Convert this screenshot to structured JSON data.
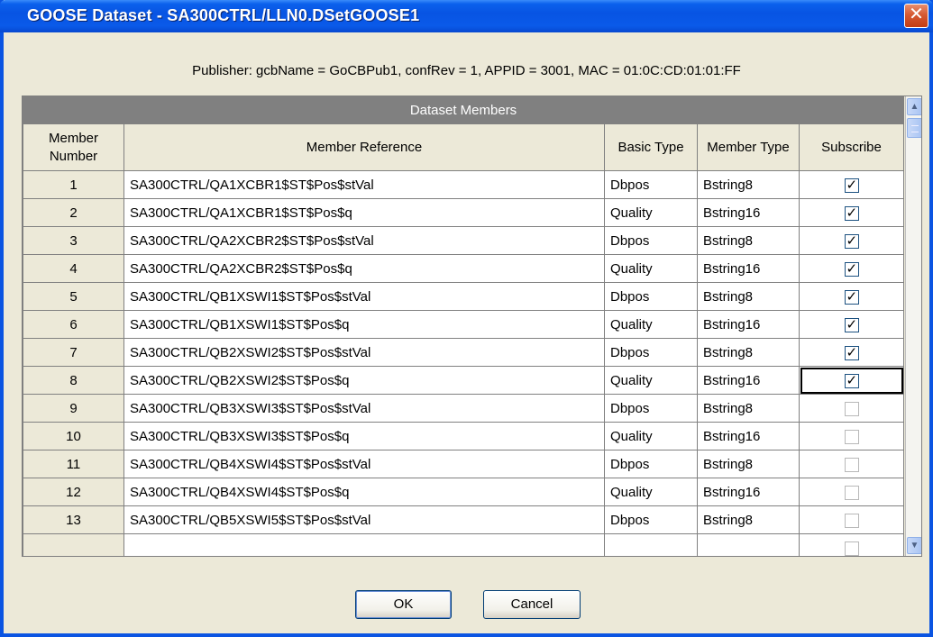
{
  "window": {
    "title": "GOOSE Dataset - SA300CTRL/LLN0.DSetGOOSE1",
    "close_glyph": "✕"
  },
  "publisher_info": "Publisher: gcbName = GoCBPub1, confRev = 1, APPID = 3001, MAC = 01:0C:CD:01:01:FF",
  "grid": {
    "banner": "Dataset Members",
    "headers": {
      "member_number": "Member Number",
      "member_reference": "Member Reference",
      "basic_type": "Basic Type",
      "member_type": "Member Type",
      "subscribe": "Subscribe"
    },
    "rows": [
      {
        "number": "1",
        "reference": "SA300CTRL/QA1XCBR1$ST$Pos$stVal",
        "basic_type": "Dbpos",
        "member_type": "Bstring8",
        "subscribe": true
      },
      {
        "number": "2",
        "reference": "SA300CTRL/QA1XCBR1$ST$Pos$q",
        "basic_type": "Quality",
        "member_type": "Bstring16",
        "subscribe": true
      },
      {
        "number": "3",
        "reference": "SA300CTRL/QA2XCBR2$ST$Pos$stVal",
        "basic_type": "Dbpos",
        "member_type": "Bstring8",
        "subscribe": true
      },
      {
        "number": "4",
        "reference": "SA300CTRL/QA2XCBR2$ST$Pos$q",
        "basic_type": "Quality",
        "member_type": "Bstring16",
        "subscribe": true
      },
      {
        "number": "5",
        "reference": "SA300CTRL/QB1XSWI1$ST$Pos$stVal",
        "basic_type": "Dbpos",
        "member_type": "Bstring8",
        "subscribe": true
      },
      {
        "number": "6",
        "reference": "SA300CTRL/QB1XSWI1$ST$Pos$q",
        "basic_type": "Quality",
        "member_type": "Bstring16",
        "subscribe": true
      },
      {
        "number": "7",
        "reference": "SA300CTRL/QB2XSWI2$ST$Pos$stVal",
        "basic_type": "Dbpos",
        "member_type": "Bstring8",
        "subscribe": true
      },
      {
        "number": "8",
        "reference": "SA300CTRL/QB2XSWI2$ST$Pos$q",
        "basic_type": "Quality",
        "member_type": "Bstring16",
        "subscribe": true
      },
      {
        "number": "9",
        "reference": "SA300CTRL/QB3XSWI3$ST$Pos$stVal",
        "basic_type": "Dbpos",
        "member_type": "Bstring8",
        "subscribe": false
      },
      {
        "number": "10",
        "reference": "SA300CTRL/QB3XSWI3$ST$Pos$q",
        "basic_type": "Quality",
        "member_type": "Bstring16",
        "subscribe": false
      },
      {
        "number": "11",
        "reference": "SA300CTRL/QB4XSWI4$ST$Pos$stVal",
        "basic_type": "Dbpos",
        "member_type": "Bstring8",
        "subscribe": false
      },
      {
        "number": "12",
        "reference": "SA300CTRL/QB4XSWI4$ST$Pos$q",
        "basic_type": "Quality",
        "member_type": "Bstring16",
        "subscribe": false
      },
      {
        "number": "13",
        "reference": "SA300CTRL/QB5XSWI5$ST$Pos$stVal",
        "basic_type": "Dbpos",
        "member_type": "Bstring8",
        "subscribe": false
      },
      {
        "number": "",
        "reference": "",
        "basic_type": "",
        "member_type": "",
        "subscribe": false
      }
    ],
    "focused_subscribe_row": "8",
    "check_glyph": "✓"
  },
  "scrollbar": {
    "up_glyph": "▲",
    "down_glyph": "▼"
  },
  "buttons": {
    "ok_label": "OK",
    "cancel_label": "Cancel"
  }
}
